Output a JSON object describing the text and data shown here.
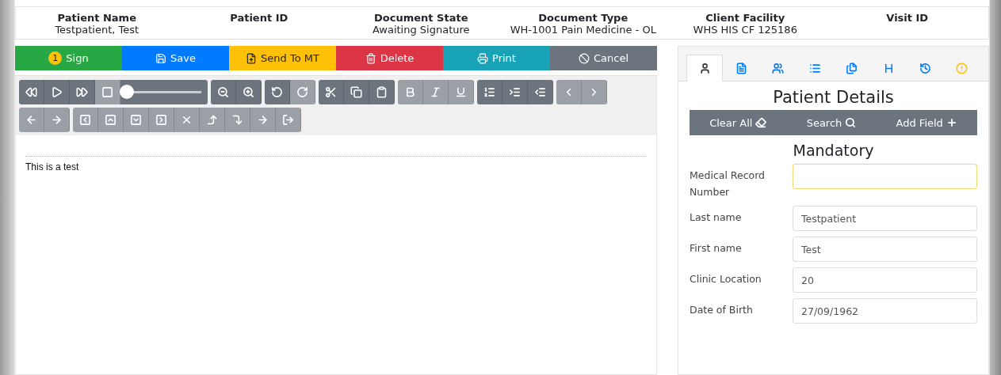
{
  "header": [
    {
      "label": "Patient Name",
      "value": "Testpatient, Test"
    },
    {
      "label": "Patient ID"
    },
    {
      "label": "Document State",
      "value": "Awaiting Signature"
    },
    {
      "label": "Document Type",
      "value": "WH-1001 Pain Medicine - OL"
    },
    {
      "label": "Client Facility",
      "value": "WHS HIS CF 125186"
    },
    {
      "label": "Visit ID"
    }
  ],
  "actions": [
    {
      "label": "Sign",
      "badge": "1",
      "color": "#28a745"
    },
    {
      "label": "Save",
      "color": "#007bff"
    },
    {
      "label": "Send To MT",
      "color": "#ffc107"
    },
    {
      "label": "Delete",
      "color": "#dc3545"
    },
    {
      "label": "Print",
      "color": "#17a2b8"
    },
    {
      "label": "Cancel",
      "color": "#6c757d"
    }
  ],
  "toolbar": [
    [
      [
        {
          "kind": "button",
          "disabled": false
        },
        {
          "kind": "button",
          "disabled": false
        },
        {
          "kind": "button",
          "disabled": false
        },
        {
          "kind": "button",
          "disabled": true
        },
        {
          "kind": "slider",
          "level": 0
        }
      ],
      [
        {
          "kind": "button",
          "disabled": false
        },
        {
          "kind": "button",
          "disabled": false
        }
      ],
      [
        {
          "kind": "button",
          "disabled": false
        },
        {
          "kind": "button",
          "disabled": true
        }
      ],
      [
        {
          "kind": "button",
          "disabled": false
        },
        {
          "kind": "button",
          "disabled": false
        },
        {
          "kind": "button",
          "disabled": false
        }
      ],
      [
        {
          "kind": "button",
          "disabled": true
        },
        {
          "kind": "button",
          "disabled": true
        },
        {
          "kind": "button",
          "disabled": true
        }
      ],
      [
        {
          "kind": "button",
          "disabled": false
        },
        {
          "kind": "button",
          "disabled": false
        },
        {
          "kind": "button",
          "disabled": false
        }
      ],
      [
        {
          "kind": "button",
          "disabled": true
        },
        {
          "kind": "button",
          "disabled": true
        }
      ]
    ],
    [
      [
        {
          "kind": "button",
          "disabled": true
        },
        {
          "kind": "button",
          "disabled": true
        }
      ],
      [
        {
          "kind": "button",
          "disabled": true
        },
        {
          "kind": "button",
          "disabled": true
        },
        {
          "kind": "button",
          "disabled": true
        },
        {
          "kind": "button",
          "disabled": true
        },
        {
          "kind": "button",
          "disabled": true
        },
        {
          "kind": "button",
          "disabled": true
        },
        {
          "kind": "button",
          "disabled": true
        },
        {
          "kind": "button",
          "disabled": true
        },
        {
          "kind": "button",
          "disabled": true
        }
      ]
    ]
  ],
  "editor": {
    "text": "This is a test"
  },
  "panel": {
    "tabs": [
      {
        "selected": true
      },
      {
        "selected": false
      },
      {
        "selected": false
      },
      {
        "selected": false
      },
      {
        "selected": false
      },
      {
        "selected": false
      },
      {
        "selected": false
      },
      {
        "selected": false
      }
    ],
    "title": "Patient Details",
    "tools": [
      "Clear All",
      "Search",
      "Add Field"
    ],
    "section": "Mandatory",
    "fields": [
      {
        "label": "Medical Record Number",
        "required": true
      },
      {
        "label": "Last name",
        "value": "Testpatient",
        "required": false
      },
      {
        "label": "First name",
        "value": "Test",
        "required": false
      },
      {
        "label": "Clinic Location",
        "value": "20",
        "required": false
      },
      {
        "label": "Date of Birth",
        "value": "27/09/1962",
        "required": false
      }
    ]
  }
}
